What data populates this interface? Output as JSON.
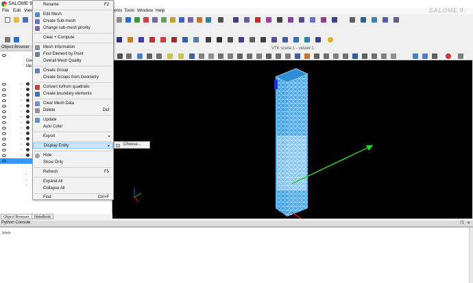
{
  "window": {
    "title": "SALOME 9.8.0 -",
    "brand": "SALOME 9"
  },
  "menubar": {
    "items": [
      "File",
      "Edit",
      "View",
      "ents",
      "Tools",
      "Window",
      "Help"
    ]
  },
  "object_browser": {
    "title": "Object Browser",
    "geom_label": "Geo",
    "mesh_label": "Me"
  },
  "tabs": [
    "Object Browser",
    "NoteBook"
  ],
  "viewer": {
    "title": "VTK scene:1 - viewer:1"
  },
  "python_console": {
    "title": "Python Console",
    "prompt": ">>>",
    "float_icon": "restore-icon",
    "close_icon": "close-icon"
  },
  "context_menu": {
    "items": [
      {
        "label": "Rename",
        "shortcut": "F2",
        "icon": ""
      },
      {
        "label": "Edit Mesh",
        "icon": "mesh-icon"
      },
      {
        "label": "Create Sub-mesh",
        "icon": "submesh-icon"
      },
      {
        "label": "Change sub-mesh priority",
        "icon": "priority-icon"
      },
      {
        "label": "Clear + Compute",
        "icon": ""
      },
      {
        "label": "Mesh Information",
        "icon": "info-icon"
      },
      {
        "label": "Find Element by Point",
        "icon": "find-icon"
      },
      {
        "label": "Overall Mesh Quality",
        "icon": ""
      },
      {
        "label": "Create Group",
        "icon": "group-icon"
      },
      {
        "label": "Create Groups from Geometry",
        "icon": ""
      },
      {
        "label": "Convert to/from quadratic",
        "icon": "quadratic-icon"
      },
      {
        "label": "Create boundary elements",
        "icon": "boundary-icon"
      },
      {
        "label": "Clear Mesh Data",
        "icon": "clear-icon"
      },
      {
        "label": "Delete",
        "shortcut": "Del",
        "icon": "delete-icon"
      },
      {
        "label": "Update",
        "icon": "update-icon"
      },
      {
        "label": "Auto Color",
        "icon": ""
      },
      {
        "label": "Export",
        "submenu": true,
        "icon": ""
      },
      {
        "label": "Display Entity",
        "submenu": true,
        "icon": ""
      },
      {
        "label": "Hide",
        "icon": "hide-icon"
      },
      {
        "label": "Show Only",
        "icon": ""
      },
      {
        "label": "Refresh",
        "shortcut": "F5",
        "icon": ""
      },
      {
        "label": "Expand All",
        "icon": ""
      },
      {
        "label": "Collapse All",
        "icon": ""
      },
      {
        "label": "Find",
        "shortcut": "Ctrl+F",
        "icon": ""
      }
    ],
    "submenu_arrow": "▸"
  },
  "display_entity_submenu": {
    "items": [
      {
        "label": "Choose..."
      }
    ]
  }
}
